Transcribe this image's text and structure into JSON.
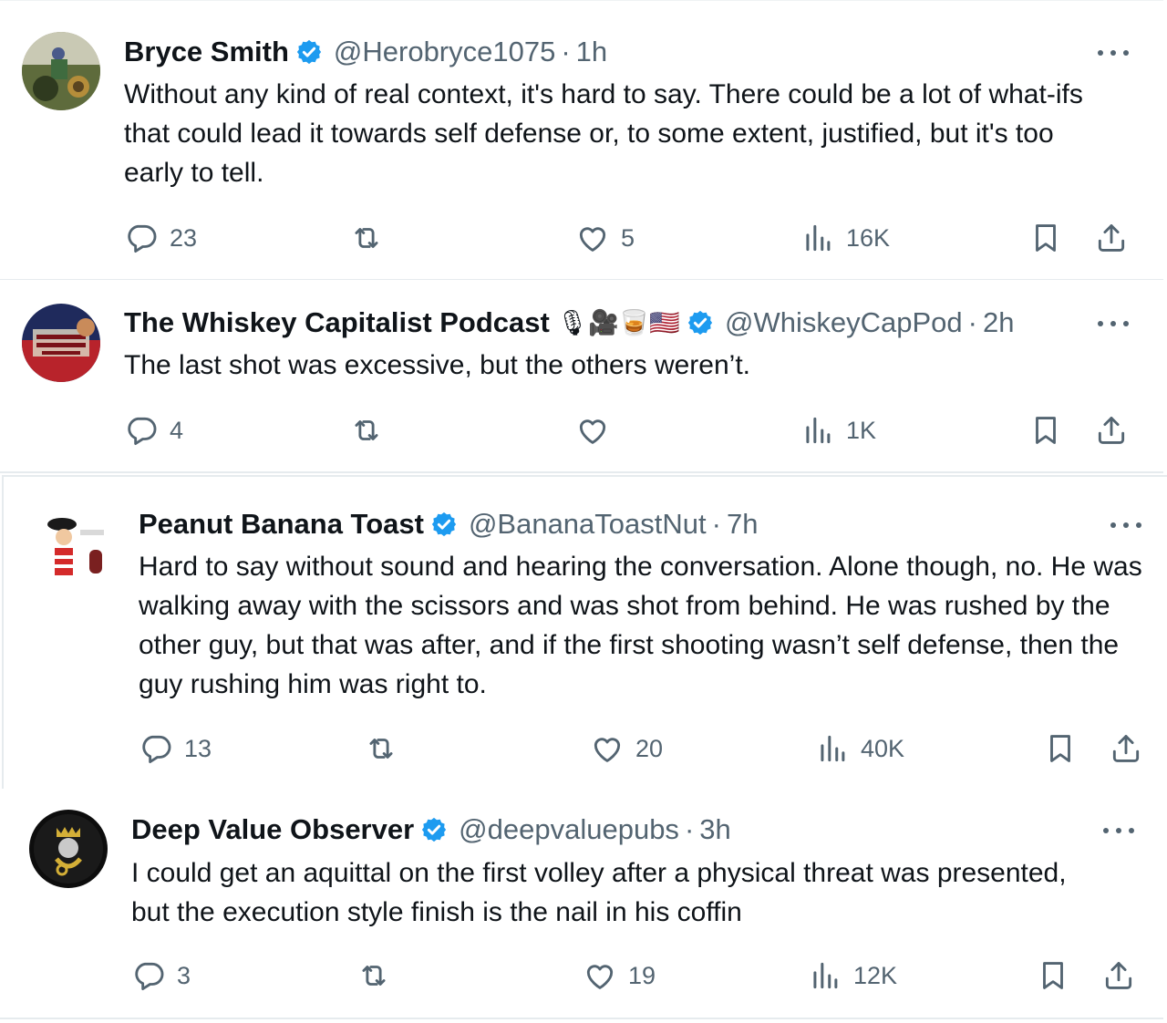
{
  "tweets": [
    {
      "name": "Bryce Smith",
      "handle": "@Herobryce1075",
      "separator": "·",
      "time": "1h",
      "text": "Without any kind of real context, it's hard to say. There could be a lot of what-ifs that could lead it towards self defense or, to some extent, justified, but it's too early to tell.",
      "replies": "23",
      "retweets": "",
      "likes": "5",
      "views": "16K"
    },
    {
      "name": "The Whiskey Capitalist Podcast",
      "name_emoji": "🎙🎥🥃🇺🇸",
      "handle": "@WhiskeyCapPod",
      "separator": "·",
      "time": "2h",
      "text": "The last shot was excessive, but the others weren’t.",
      "replies": "4",
      "retweets": "",
      "likes": "",
      "views": "1K"
    },
    {
      "name": "Peanut Banana Toast",
      "handle": "@BananaToastNut",
      "separator": "·",
      "time": "7h",
      "text": "Hard to say without sound and hearing the conversation. Alone though, no. He was walking away with the scissors and was shot from behind. He was rushed by the other guy, but that was after, and if the first shooting wasn’t self defense, then the guy rushing him was right to.",
      "replies": "13",
      "retweets": "",
      "likes": "20",
      "views": "40K"
    },
    {
      "name": "Deep Value Observer",
      "handle": "@deepvaluepubs",
      "separator": "·",
      "time": "3h",
      "text": "I could get an aquittal on the first volley after a physical threat was presented, but the execution style finish is the nail in his coffin",
      "replies": "3",
      "retweets": "",
      "likes": "19",
      "views": "12K"
    }
  ],
  "icons": {
    "reply": "reply-icon",
    "retweet": "retweet-icon",
    "like": "heart-icon",
    "views": "views-icon",
    "bookmark": "bookmark-icon",
    "share": "share-icon",
    "verified": "verified-badge-icon",
    "more": "more-icon"
  },
  "colors": {
    "verified": "#1d9bf0",
    "muted": "#536471",
    "text": "#0f1419"
  }
}
